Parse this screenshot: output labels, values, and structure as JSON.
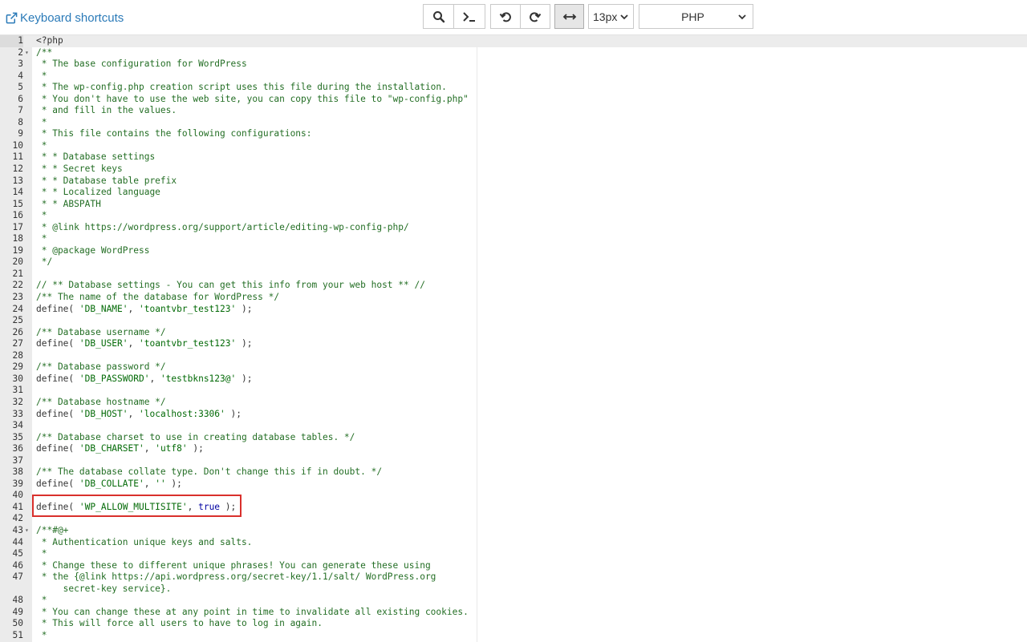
{
  "toolbar": {
    "keyboard_shortcuts": "Keyboard shortcuts",
    "font_size": "13px",
    "mode": "PHP",
    "icons": [
      "external-link-icon",
      "search-icon",
      "terminal-icon",
      "undo-icon",
      "redo-icon",
      "wrap-icon",
      "chevron-down-icon"
    ]
  },
  "colors": {
    "comment": "#236e24",
    "string": "#036a07",
    "keyword": "#0000a2",
    "highlight": "#d9302c",
    "link": "#2a7ab8"
  },
  "code_lines": [
    {
      "n": "1",
      "fold": false,
      "segs": [
        [
          "t",
          "<?php"
        ]
      ]
    },
    {
      "n": "2",
      "fold": true,
      "segs": [
        [
          "c",
          "/**"
        ]
      ]
    },
    {
      "n": "3",
      "fold": false,
      "segs": [
        [
          "c",
          " * The base configuration for WordPress"
        ]
      ]
    },
    {
      "n": "4",
      "fold": false,
      "segs": [
        [
          "c",
          " *"
        ]
      ]
    },
    {
      "n": "5",
      "fold": false,
      "segs": [
        [
          "c",
          " * The wp-config.php creation script uses this file during the installation."
        ]
      ]
    },
    {
      "n": "6",
      "fold": false,
      "segs": [
        [
          "c",
          " * You don't have to use the web site, you can copy this file to \"wp-config.php\""
        ]
      ]
    },
    {
      "n": "7",
      "fold": false,
      "segs": [
        [
          "c",
          " * and fill in the values."
        ]
      ]
    },
    {
      "n": "8",
      "fold": false,
      "segs": [
        [
          "c",
          " *"
        ]
      ]
    },
    {
      "n": "9",
      "fold": false,
      "segs": [
        [
          "c",
          " * This file contains the following configurations:"
        ]
      ]
    },
    {
      "n": "10",
      "fold": false,
      "segs": [
        [
          "c",
          " *"
        ]
      ]
    },
    {
      "n": "11",
      "fold": false,
      "segs": [
        [
          "c",
          " * * Database settings"
        ]
      ]
    },
    {
      "n": "12",
      "fold": false,
      "segs": [
        [
          "c",
          " * * Secret keys"
        ]
      ]
    },
    {
      "n": "13",
      "fold": false,
      "segs": [
        [
          "c",
          " * * Database table prefix"
        ]
      ]
    },
    {
      "n": "14",
      "fold": false,
      "segs": [
        [
          "c",
          " * * Localized language"
        ]
      ]
    },
    {
      "n": "15",
      "fold": false,
      "segs": [
        [
          "c",
          " * * ABSPATH"
        ]
      ]
    },
    {
      "n": "16",
      "fold": false,
      "segs": [
        [
          "c",
          " *"
        ]
      ]
    },
    {
      "n": "17",
      "fold": false,
      "segs": [
        [
          "c",
          " * @link https://wordpress.org/support/article/editing-wp-config-php/"
        ]
      ]
    },
    {
      "n": "18",
      "fold": false,
      "segs": [
        [
          "c",
          " *"
        ]
      ]
    },
    {
      "n": "19",
      "fold": false,
      "segs": [
        [
          "c",
          " * @package WordPress"
        ]
      ]
    },
    {
      "n": "20",
      "fold": false,
      "segs": [
        [
          "c",
          " */"
        ]
      ]
    },
    {
      "n": "21",
      "fold": false,
      "segs": []
    },
    {
      "n": "22",
      "fold": false,
      "segs": [
        [
          "c",
          "// ** Database settings - You can get this info from your web host ** //"
        ]
      ]
    },
    {
      "n": "23",
      "fold": false,
      "segs": [
        [
          "c",
          "/** The name of the database for WordPress */"
        ]
      ]
    },
    {
      "n": "24",
      "fold": false,
      "segs": [
        [
          "t",
          "define( "
        ],
        [
          "s",
          "'DB_NAME'"
        ],
        [
          "t",
          ", "
        ],
        [
          "s",
          "'toantvbr_test123'"
        ],
        [
          "t",
          " );"
        ]
      ]
    },
    {
      "n": "25",
      "fold": false,
      "segs": []
    },
    {
      "n": "26",
      "fold": false,
      "segs": [
        [
          "c",
          "/** Database username */"
        ]
      ]
    },
    {
      "n": "27",
      "fold": false,
      "segs": [
        [
          "t",
          "define( "
        ],
        [
          "s",
          "'DB_USER'"
        ],
        [
          "t",
          ", "
        ],
        [
          "s",
          "'toantvbr_test123'"
        ],
        [
          "t",
          " );"
        ]
      ]
    },
    {
      "n": "28",
      "fold": false,
      "segs": []
    },
    {
      "n": "29",
      "fold": false,
      "segs": [
        [
          "c",
          "/** Database password */"
        ]
      ]
    },
    {
      "n": "30",
      "fold": false,
      "segs": [
        [
          "t",
          "define( "
        ],
        [
          "s",
          "'DB_PASSWORD'"
        ],
        [
          "t",
          ", "
        ],
        [
          "s",
          "'testbkns123@'"
        ],
        [
          "t",
          " );"
        ]
      ]
    },
    {
      "n": "31",
      "fold": false,
      "segs": []
    },
    {
      "n": "32",
      "fold": false,
      "segs": [
        [
          "c",
          "/** Database hostname */"
        ]
      ]
    },
    {
      "n": "33",
      "fold": false,
      "segs": [
        [
          "t",
          "define( "
        ],
        [
          "s",
          "'DB_HOST'"
        ],
        [
          "t",
          ", "
        ],
        [
          "s",
          "'localhost:3306'"
        ],
        [
          "t",
          " );"
        ]
      ]
    },
    {
      "n": "34",
      "fold": false,
      "segs": []
    },
    {
      "n": "35",
      "fold": false,
      "segs": [
        [
          "c",
          "/** Database charset to use in creating database tables. */"
        ]
      ]
    },
    {
      "n": "36",
      "fold": false,
      "segs": [
        [
          "t",
          "define( "
        ],
        [
          "s",
          "'DB_CHARSET'"
        ],
        [
          "t",
          ", "
        ],
        [
          "s",
          "'utf8'"
        ],
        [
          "t",
          " );"
        ]
      ]
    },
    {
      "n": "37",
      "fold": false,
      "segs": []
    },
    {
      "n": "38",
      "fold": false,
      "segs": [
        [
          "c",
          "/** The database collate type. Don't change this if in doubt. */"
        ]
      ]
    },
    {
      "n": "39",
      "fold": false,
      "segs": [
        [
          "t",
          "define( "
        ],
        [
          "s",
          "'DB_COLLATE'"
        ],
        [
          "t",
          ", "
        ],
        [
          "s",
          "''"
        ],
        [
          "t",
          " );"
        ]
      ]
    },
    {
      "n": "40",
      "fold": false,
      "segs": []
    },
    {
      "n": "41",
      "fold": false,
      "segs": [
        [
          "t",
          "define( "
        ],
        [
          "s",
          "'WP_ALLOW_MULTISITE'"
        ],
        [
          "t",
          ", "
        ],
        [
          "k",
          "true"
        ],
        [
          "t",
          " );"
        ]
      ]
    },
    {
      "n": "42",
      "fold": false,
      "segs": []
    },
    {
      "n": "43",
      "fold": true,
      "segs": [
        [
          "c",
          "/**#@+"
        ]
      ]
    },
    {
      "n": "44",
      "fold": false,
      "segs": [
        [
          "c",
          " * Authentication unique keys and salts."
        ]
      ]
    },
    {
      "n": "45",
      "fold": false,
      "segs": [
        [
          "c",
          " *"
        ]
      ]
    },
    {
      "n": "46",
      "fold": false,
      "segs": [
        [
          "c",
          " * Change these to different unique phrases! You can generate these using"
        ]
      ]
    },
    {
      "n": "47",
      "fold": false,
      "segs": [
        [
          "c",
          " * the {@link https://api.wordpress.org/secret-key/1.1/salt/ WordPress.org"
        ]
      ]
    },
    {
      "n": "",
      "fold": false,
      "segs": [
        [
          "c",
          "     secret-key service}."
        ]
      ]
    },
    {
      "n": "48",
      "fold": false,
      "segs": [
        [
          "c",
          " *"
        ]
      ]
    },
    {
      "n": "49",
      "fold": false,
      "segs": [
        [
          "c",
          " * You can change these at any point in time to invalidate all existing cookies."
        ]
      ]
    },
    {
      "n": "50",
      "fold": false,
      "segs": [
        [
          "c",
          " * This will force all users to have to log in again."
        ]
      ]
    },
    {
      "n": "51",
      "fold": false,
      "segs": [
        [
          "c",
          " *"
        ]
      ]
    }
  ]
}
